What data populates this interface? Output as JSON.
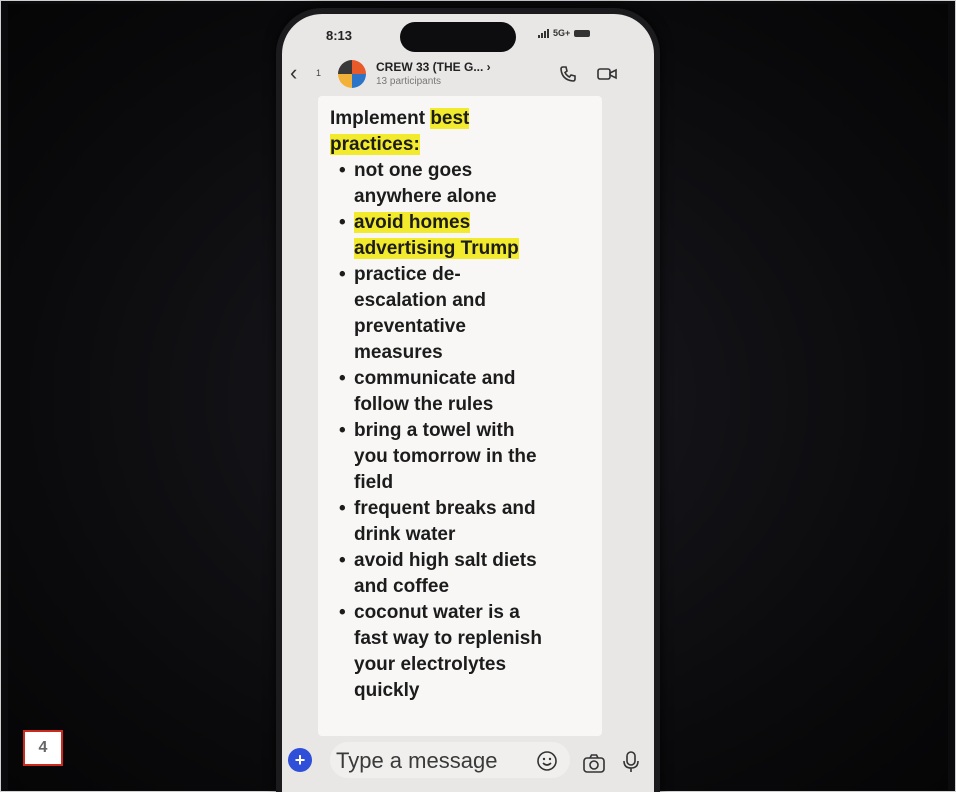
{
  "status_bar": {
    "time": "8:13",
    "network": "5G+"
  },
  "header": {
    "back_count": "1",
    "title": "CREW 33 (THE G... ›",
    "subtitle": "13 participants",
    "icons": [
      "back-chevron-icon",
      "group-avatar",
      "phone-icon",
      "video-icon"
    ]
  },
  "message": {
    "intro_plain": "Implement ",
    "intro_highlight_1": "best",
    "intro_highlight_2": "practices:",
    "bullets": [
      {
        "lines": [
          "not one goes",
          "anywhere alone"
        ],
        "highlight": false
      },
      {
        "lines": [
          "avoid homes",
          "advertising Trump"
        ],
        "highlight": true
      },
      {
        "lines": [
          "practice de-",
          "escalation and",
          "preventative",
          "measures"
        ],
        "highlight": false
      },
      {
        "lines": [
          "communicate and",
          "follow the rules"
        ],
        "highlight": false
      },
      {
        "lines": [
          "bring a towel with",
          "you tomorrow in the",
          "field"
        ],
        "highlight": false
      },
      {
        "lines": [
          "frequent breaks and",
          "drink water"
        ],
        "highlight": false
      },
      {
        "lines": [
          "avoid high salt diets",
          "and coffee"
        ],
        "highlight": false
      },
      {
        "lines": [
          "coconut water is a",
          "fast way to replenish",
          "your electrolytes",
          "quickly"
        ],
        "highlight": false
      }
    ],
    "bullet_char": "•",
    "highlight_color": "#f2ea2c"
  },
  "composer": {
    "plus_label": "+",
    "placeholder": "Type a message",
    "icons": [
      "plus-icon",
      "emoji-icon",
      "camera-icon",
      "mic-icon"
    ]
  },
  "page_badge": "4"
}
